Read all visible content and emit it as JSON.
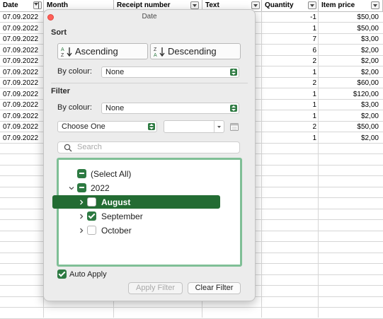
{
  "sheet": {
    "columns": [
      "Date",
      "Month",
      "Receipt number",
      "Text",
      "Quantity",
      "Item price"
    ],
    "rows": [
      {
        "date": "07.09.2022",
        "quantity": "-1",
        "price": "$50,00"
      },
      {
        "date": "07.09.2022",
        "quantity": "1",
        "price": "$50,00"
      },
      {
        "date": "07.09.2022",
        "quantity": "7",
        "price": "$3,00"
      },
      {
        "date": "07.09.2022",
        "quantity": "6",
        "price": "$2,00"
      },
      {
        "date": "07.09.2022",
        "quantity": "2",
        "price": "$2,00"
      },
      {
        "date": "07.09.2022",
        "quantity": "1",
        "price": "$2,00"
      },
      {
        "date": "07.09.2022",
        "quantity": "2",
        "price": "$60,00"
      },
      {
        "date": "07.09.2022",
        "quantity": "1",
        "price": "$120,00"
      },
      {
        "date": "07.09.2022",
        "quantity": "1",
        "price": "$3,00"
      },
      {
        "date": "07.09.2022",
        "quantity": "1",
        "price": "$2,00"
      },
      {
        "date": "07.09.2022",
        "quantity": "2",
        "price": "$50,00"
      },
      {
        "date": "07.09.2022",
        "quantity": "1",
        "price": "$2,00"
      }
    ]
  },
  "popover": {
    "title": "Date",
    "sort_heading": "Sort",
    "ascending_label": "Ascending",
    "descending_label": "Descending",
    "by_colour_label": "By colour:",
    "sort_colour_value": "None",
    "filter_heading": "Filter",
    "filter_colour_value": "None",
    "choose_one": "Choose One",
    "search_placeholder": "Search",
    "items": [
      {
        "label": "(Select All)",
        "state": "mixed"
      },
      {
        "label": "2022",
        "state": "mixed"
      },
      {
        "label": "August",
        "state": "unchecked"
      },
      {
        "label": "September",
        "state": "checked"
      },
      {
        "label": "October",
        "state": "unchecked"
      }
    ],
    "auto_apply_label": "Auto Apply",
    "apply_filter_label": "Apply Filter",
    "clear_filter_label": "Clear Filter"
  },
  "colors": {
    "accent": "#2d7a42",
    "highlight": "#236c33",
    "list_border": "#7fbf96",
    "close": "#fe5f57"
  }
}
